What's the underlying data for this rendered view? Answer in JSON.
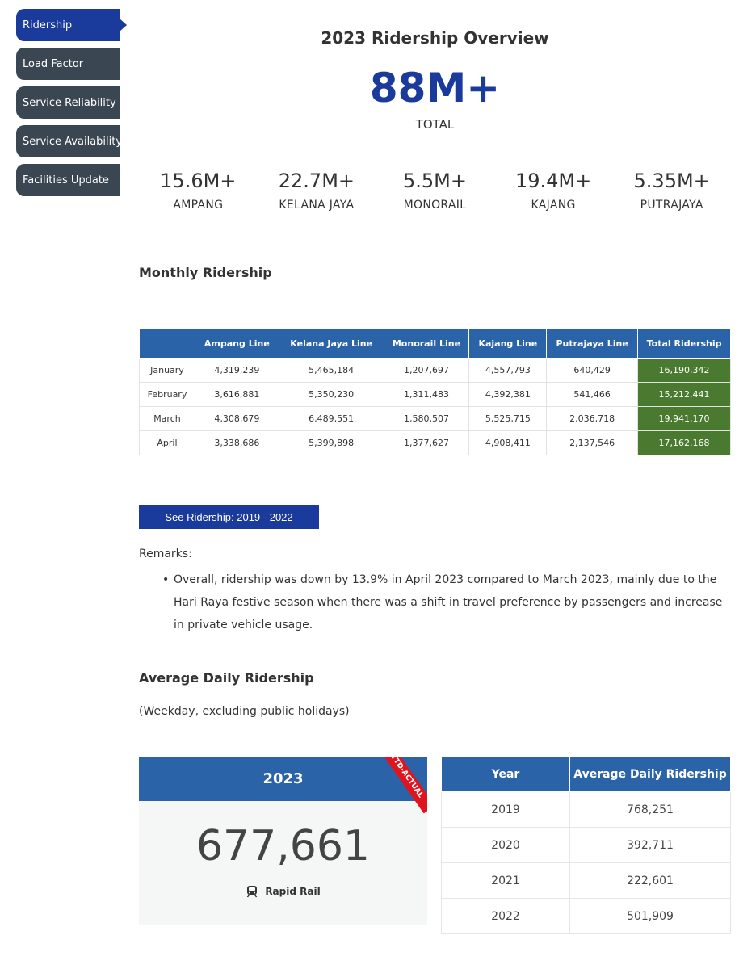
{
  "sidebar": {
    "items": [
      {
        "label": "Ridership",
        "active": true
      },
      {
        "label": "Load Factor"
      },
      {
        "label": "Service Reliability"
      },
      {
        "label": "Service Availability"
      },
      {
        "label": "Facilities Update"
      }
    ]
  },
  "overview": {
    "title": "2023 Ridership Overview",
    "total_value": "88M+",
    "total_label": "TOTAL",
    "lines": [
      {
        "value": "15.6M+",
        "label": "AMPANG"
      },
      {
        "value": "22.7M+",
        "label": "KELANA JAYA"
      },
      {
        "value": "5.5M+",
        "label": "MONORAIL"
      },
      {
        "value": "19.4M+",
        "label": "KAJANG"
      },
      {
        "value": "5.35M+",
        "label": "PUTRAJAYA"
      }
    ]
  },
  "monthly": {
    "title": "Monthly Ridership",
    "columns": [
      "",
      "Ampang Line",
      "Kelana Jaya Line",
      "Monorail Line",
      "Kajang Line",
      "Putrajaya Line",
      "Total Ridership"
    ],
    "rows": [
      [
        "January",
        "4,319,239",
        "5,465,184",
        "1,207,697",
        "4,557,793",
        "640,429",
        "16,190,342"
      ],
      [
        "February",
        "3,616,881",
        "5,350,230",
        "1,311,483",
        "4,392,381",
        "541,466",
        "15,212,441"
      ],
      [
        "March",
        "4,308,679",
        "6,489,551",
        "1,580,507",
        "5,525,715",
        "2,036,718",
        "19,941,170"
      ],
      [
        "April",
        "3,338,686",
        "5,399,898",
        "1,377,627",
        "4,908,411",
        "2,137,546",
        "17,162,168"
      ]
    ],
    "see_button": "See Ridership: 2019 - 2022"
  },
  "remarks": {
    "label": "Remarks:",
    "bullet": "•",
    "items": [
      "Overall, ridership was down by 13.9% in April 2023 compared to March 2023, mainly due to the Hari Raya festive season when there was a shift in travel preference by passengers and increase in private vehicle usage."
    ]
  },
  "average": {
    "title": "Average Daily Ridership",
    "note": "(Weekday, excluding public holidays)",
    "card": {
      "year": "2023",
      "ribbon": "YTD-ACTUAL",
      "value": "677,661",
      "icon": "train-icon",
      "label": "Rapid Rail"
    },
    "table": {
      "columns": [
        "Year",
        "Average Daily Ridership"
      ],
      "rows": [
        [
          "2019",
          "768,251"
        ],
        [
          "2020",
          "392,711"
        ],
        [
          "2021",
          "222,601"
        ],
        [
          "2022",
          "501,909"
        ]
      ]
    }
  },
  "colors": {
    "primary": "#1a3a9c",
    "header_blue": "#2b63a8",
    "sidebar_dark": "#3a4651",
    "total_green": "#4a7a2f",
    "ribbon_red": "#e0141e"
  }
}
